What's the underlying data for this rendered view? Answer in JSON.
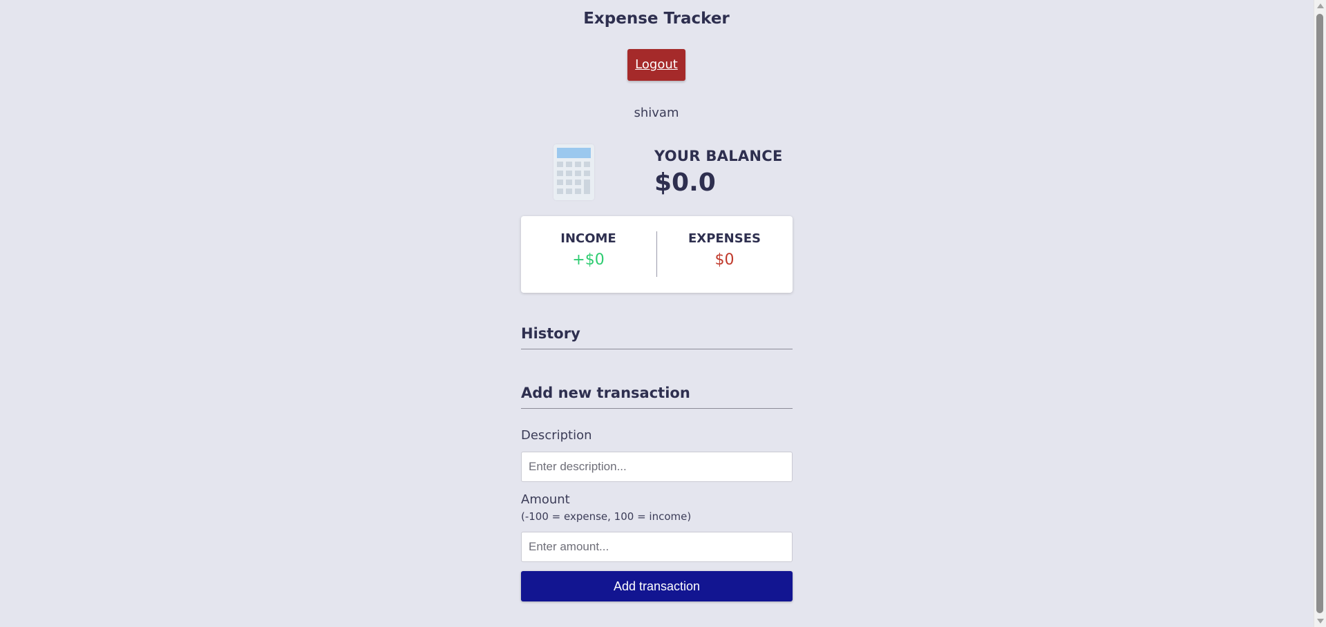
{
  "app": {
    "title": "Expense Tracker",
    "logout_label": "Logout",
    "username": "shivam"
  },
  "balance": {
    "label": "YOUR BALANCE",
    "value": "$0.0"
  },
  "summary": {
    "income_label": "INCOME",
    "income_value": "+$0",
    "expenses_label": "EXPENSES",
    "expenses_value": "$0"
  },
  "history": {
    "heading": "History"
  },
  "form": {
    "heading": "Add new transaction",
    "description_label": "Description",
    "description_placeholder": "Enter description...",
    "amount_label": "Amount",
    "amount_hint": "(-100 = expense, 100 = income)",
    "amount_placeholder": "Enter amount...",
    "submit_label": "Add transaction"
  },
  "colors": {
    "background": "#e4e5ee",
    "logout_button": "#a52a2a",
    "income": "#2ecc71",
    "expense": "#c0392b",
    "submit_button": "#121591"
  },
  "icons": {
    "balance_icon": "calculator-icon"
  }
}
